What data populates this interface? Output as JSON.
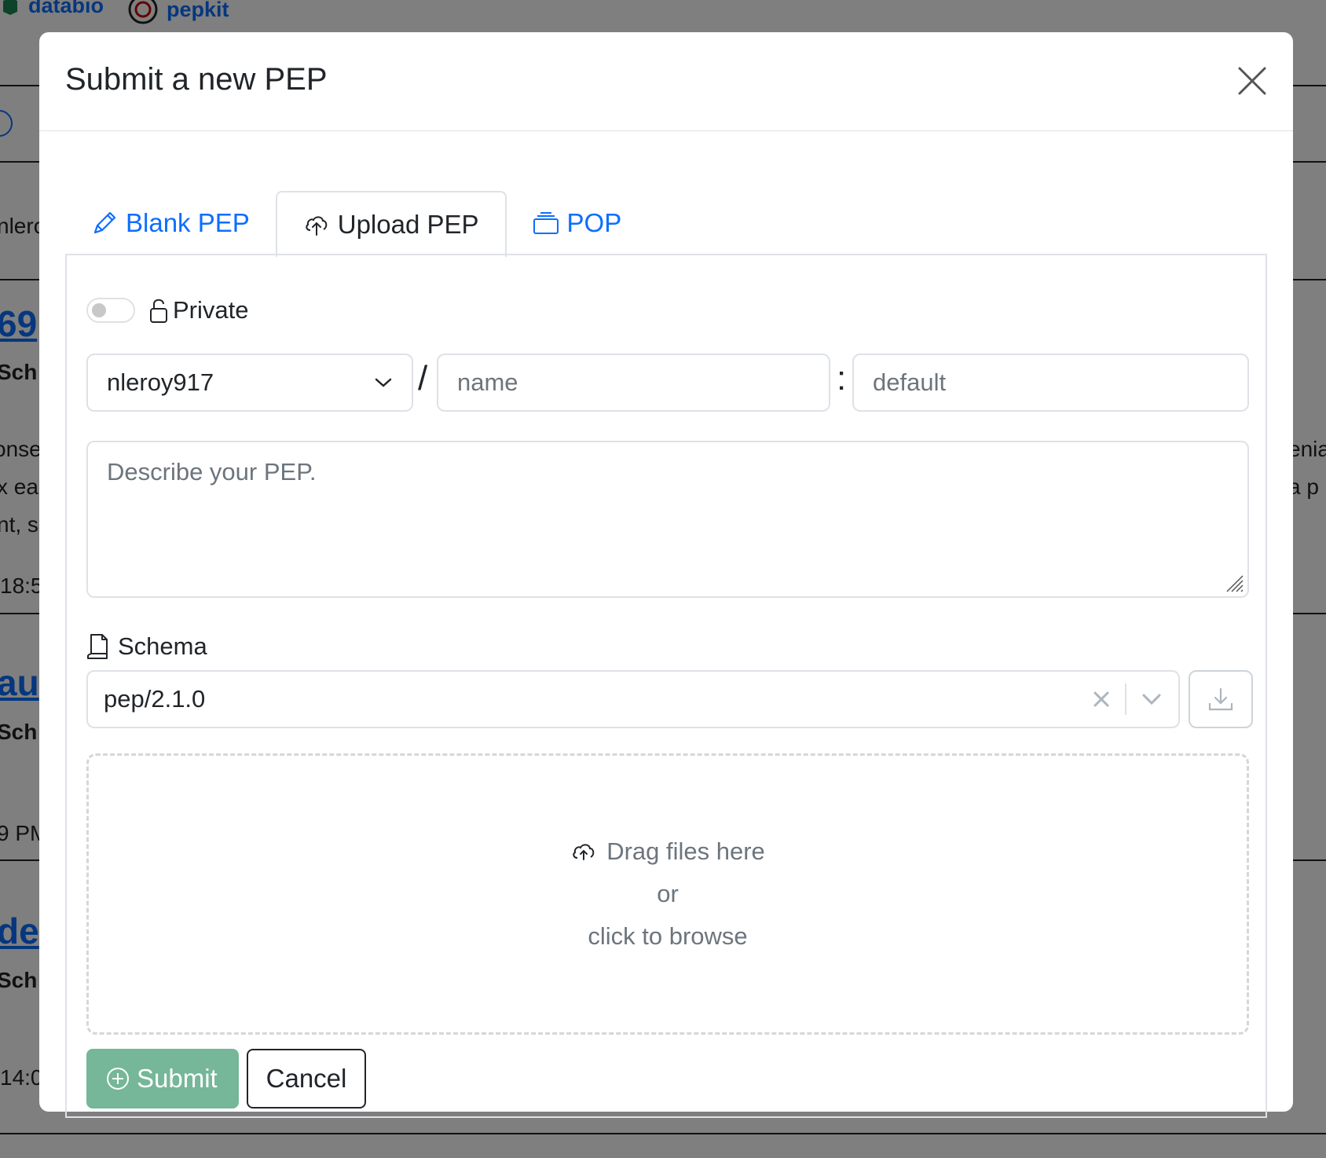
{
  "background": {
    "brand_1": "databio",
    "brand_2": "pepkit",
    "fragments": {
      "f1": "nlero",
      "f2": "69",
      "f3": "Sch",
      "f4": "onse",
      "f5": "x ea",
      "f6": "nt, s",
      "f7": "18:5",
      "f8": "au",
      "f9": "Sch",
      "f10": "9 PM",
      "f11": "de",
      "f12": "Sch",
      "f13": "14:0",
      "f14": "enia",
      "f15": "a p"
    }
  },
  "modal": {
    "title": "Submit a new PEP",
    "close_icon": "close-icon"
  },
  "tabs": [
    {
      "label": "Blank PEP",
      "icon": "pencil-icon",
      "active": false
    },
    {
      "label": "Upload PEP",
      "icon": "cloud-upload-icon",
      "active": true
    },
    {
      "label": "POP",
      "icon": "stack-icon",
      "active": false
    }
  ],
  "form": {
    "private_label": "Private",
    "private_on": false,
    "namespace_value": "nleroy917",
    "slash": "/",
    "name_placeholder": "name",
    "colon": ":",
    "tag_placeholder": "default",
    "description_placeholder": "Describe your PEP.",
    "schema_label": "Schema",
    "schema_value": "pep/2.1.0",
    "dropzone": {
      "line1": "Drag files here",
      "line2": "or",
      "line3": "click to browse"
    },
    "submit_label": "Submit",
    "cancel_label": "Cancel"
  },
  "colors": {
    "link": "#0d6efd",
    "submit_bg": "#75b798",
    "border": "#dee2e6"
  }
}
